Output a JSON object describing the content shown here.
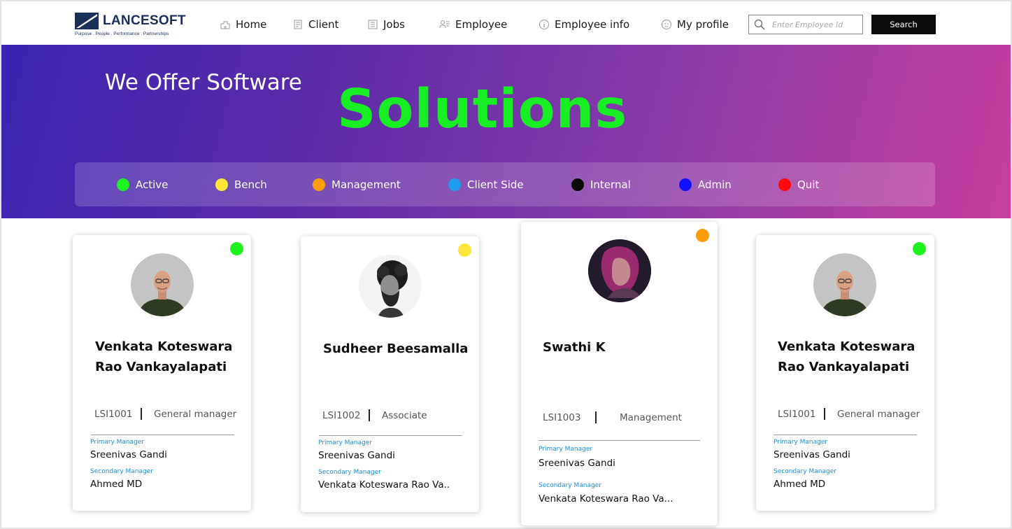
{
  "header": {
    "logo_name": "LANCESOFT",
    "logo_tagline": "Purpose . People . Performance . Partnerships",
    "nav": [
      {
        "label": "Home",
        "icon": "home-icon"
      },
      {
        "label": "Client",
        "icon": "client-icon"
      },
      {
        "label": "Jobs",
        "icon": "jobs-icon"
      },
      {
        "label": "Employee",
        "icon": "employee-icon"
      },
      {
        "label": "Employee info",
        "icon": "info-icon"
      },
      {
        "label": "My profile",
        "icon": "profile-icon"
      }
    ],
    "search_placeholder": "Enter Employee Id",
    "search_button": "Search"
  },
  "hero": {
    "line1": "We Offer Software",
    "line2": "Solutions"
  },
  "legend": [
    {
      "label": "Active",
      "color": "#1ff21f"
    },
    {
      "label": "Bench",
      "color": "#ffe53a"
    },
    {
      "label": "Management",
      "color": "#ff9d0a"
    },
    {
      "label": "Client Side",
      "color": "#1e9cf0"
    },
    {
      "label": "Internal",
      "color": "#080808"
    },
    {
      "label": "Admin",
      "color": "#1010ff"
    },
    {
      "label": "Quit",
      "color": "#ff0a0a"
    }
  ],
  "employees": [
    {
      "name": "Venkata Koteswara Rao Vankayalapati",
      "id": "LSI1001",
      "role": "General manager",
      "status_color": "#1ff21f",
      "primary_manager_label": "Primary Manager",
      "primary_manager": "Sreenivas Gandi",
      "secondary_manager_label": "Secondary Manager",
      "secondary_manager": "Ahmed MD"
    },
    {
      "name": "Sudheer Beesamalla",
      "id": "LSI1002",
      "role": "Associate",
      "status_color": "#ffe53a",
      "primary_manager_label": "Primary Manager",
      "primary_manager": "Sreenivas Gandi",
      "secondary_manager_label": "Secondary Manager",
      "secondary_manager": "Venkata Koteswara Rao Va.."
    },
    {
      "name": "Swathi K",
      "id": "LSI1003",
      "role": "Management",
      "status_color": "#ff9d0a",
      "primary_manager_label": "Primary Manager",
      "primary_manager": "Sreenivas Gandi",
      "secondary_manager_label": "Secondary Manager",
      "secondary_manager": "Venkata Koteswara Rao Va..."
    },
    {
      "name": "Venkata Koteswara Rao Vankayalapati",
      "id": "LSI1001",
      "role": "General manager",
      "status_color": "#1ff21f",
      "primary_manager_label": "Primary Manager",
      "primary_manager": "Sreenivas Gandi",
      "secondary_manager_label": "Secondary Manager",
      "secondary_manager": "Ahmed MD"
    }
  ]
}
